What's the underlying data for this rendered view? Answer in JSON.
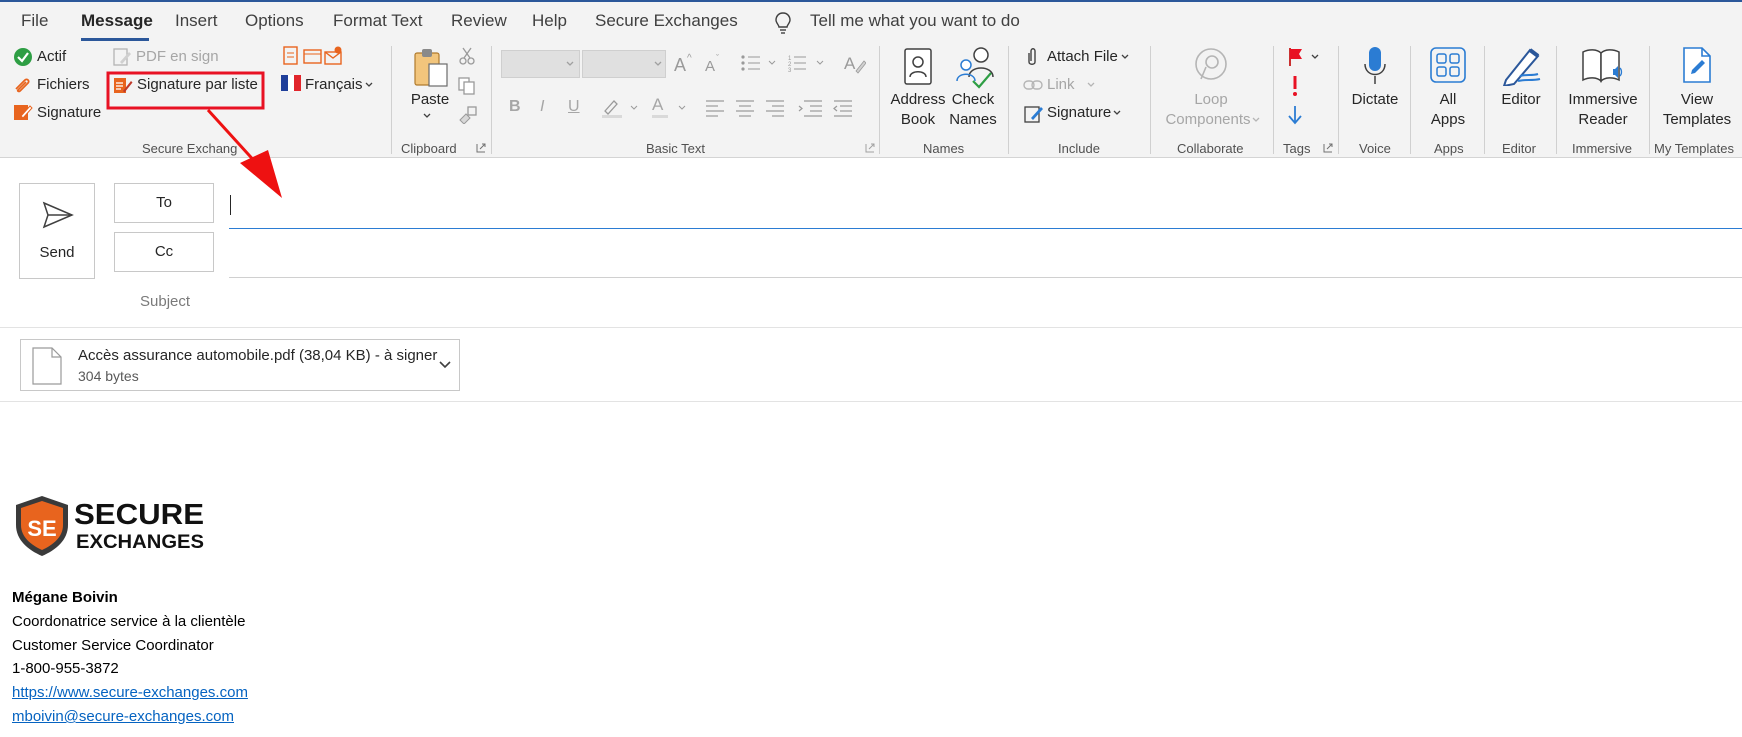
{
  "menu": {
    "tabs": [
      "File",
      "Message",
      "Insert",
      "Options",
      "Format Text",
      "Review",
      "Help",
      "Secure Exchanges"
    ],
    "active_tab": "Message",
    "tell_me": "Tell me what you want to do"
  },
  "ribbon": {
    "secure_exchanges": {
      "actif": "Actif",
      "fichiers": "Fichiers",
      "signature": "Signature",
      "pdf_en_sign": "PDF en sign",
      "signature_par_liste": "Signature par liste",
      "language": "Français",
      "group_label": "Secure Exchang"
    },
    "clipboard": {
      "paste": "Paste",
      "group_label": "Clipboard"
    },
    "basic_text": {
      "group_label": "Basic Text",
      "bold": "B",
      "italic": "I",
      "underline": "U",
      "font_color_letter": "A"
    },
    "names": {
      "address_book_1": "Address",
      "address_book_2": "Book",
      "check_names_1": "Check",
      "check_names_2": "Names",
      "group_label": "Names"
    },
    "include": {
      "attach_file": "Attach File",
      "link": "Link",
      "signature": "Signature",
      "group_label": "Include"
    },
    "collaborate": {
      "loop_1": "Loop",
      "loop_2": "Components",
      "group_label": "Collaborate"
    },
    "tags": {
      "group_label": "Tags"
    },
    "voice": {
      "dictate": "Dictate",
      "group_label": "Voice"
    },
    "apps": {
      "all_apps_1": "All",
      "all_apps_2": "Apps",
      "group_label": "Apps"
    },
    "editor": {
      "editor": "Editor",
      "group_label": "Editor"
    },
    "immersive": {
      "reader_1": "Immersive",
      "reader_2": "Reader",
      "group_label": "Immersive"
    },
    "my_templates": {
      "view_1": "View",
      "view_2": "Templates",
      "group_label": "My Templates"
    }
  },
  "compose": {
    "send": "Send",
    "to_button": "To",
    "cc_button": "Cc",
    "subject_label": "Subject",
    "to_value": "",
    "cc_value": "",
    "subject_value": ""
  },
  "attachment": {
    "name": "Accès assurance automobile.pdf (38,04 KB) - à signer",
    "size": "304 bytes"
  },
  "signature": {
    "logo_line1": "SECURE",
    "logo_line2": "EXCHANGES",
    "logo_initials": "SE",
    "name": "Mégane Boivin",
    "title_fr": "Coordonatrice service à la clientèle",
    "title_en": "Customer Service Coordinator",
    "phone": "1-800-955-3872",
    "website": "https://www.secure-exchanges.com",
    "email": "mboivin@secure-exchanges.com"
  },
  "colors": {
    "accent": "#2b579a",
    "highlight": "#e81123",
    "annotation": "#ee1111",
    "ribbon_bg": "#f3f3f3",
    "brand_orange": "#e8641e",
    "link": "#0563c1"
  },
  "icons": [
    "check-circle-icon",
    "paperclip-pen-icon",
    "signature-pen-icon",
    "pdf-sign-icon",
    "signature-list-icon",
    "french-flag-icon",
    "paste-icon",
    "scissors-icon",
    "copy-icon",
    "format-painter-icon",
    "address-book-icon",
    "check-names-icon",
    "paperclip-icon",
    "link-icon",
    "signature-icon",
    "loop-icon",
    "flag-icon",
    "high-importance-icon",
    "low-importance-icon",
    "microphone-icon",
    "apps-grid-icon",
    "editor-pen-icon",
    "immersive-reader-icon",
    "view-templates-icon",
    "send-icon",
    "file-icon",
    "chevron-down-icon",
    "lightbulb-icon"
  ]
}
